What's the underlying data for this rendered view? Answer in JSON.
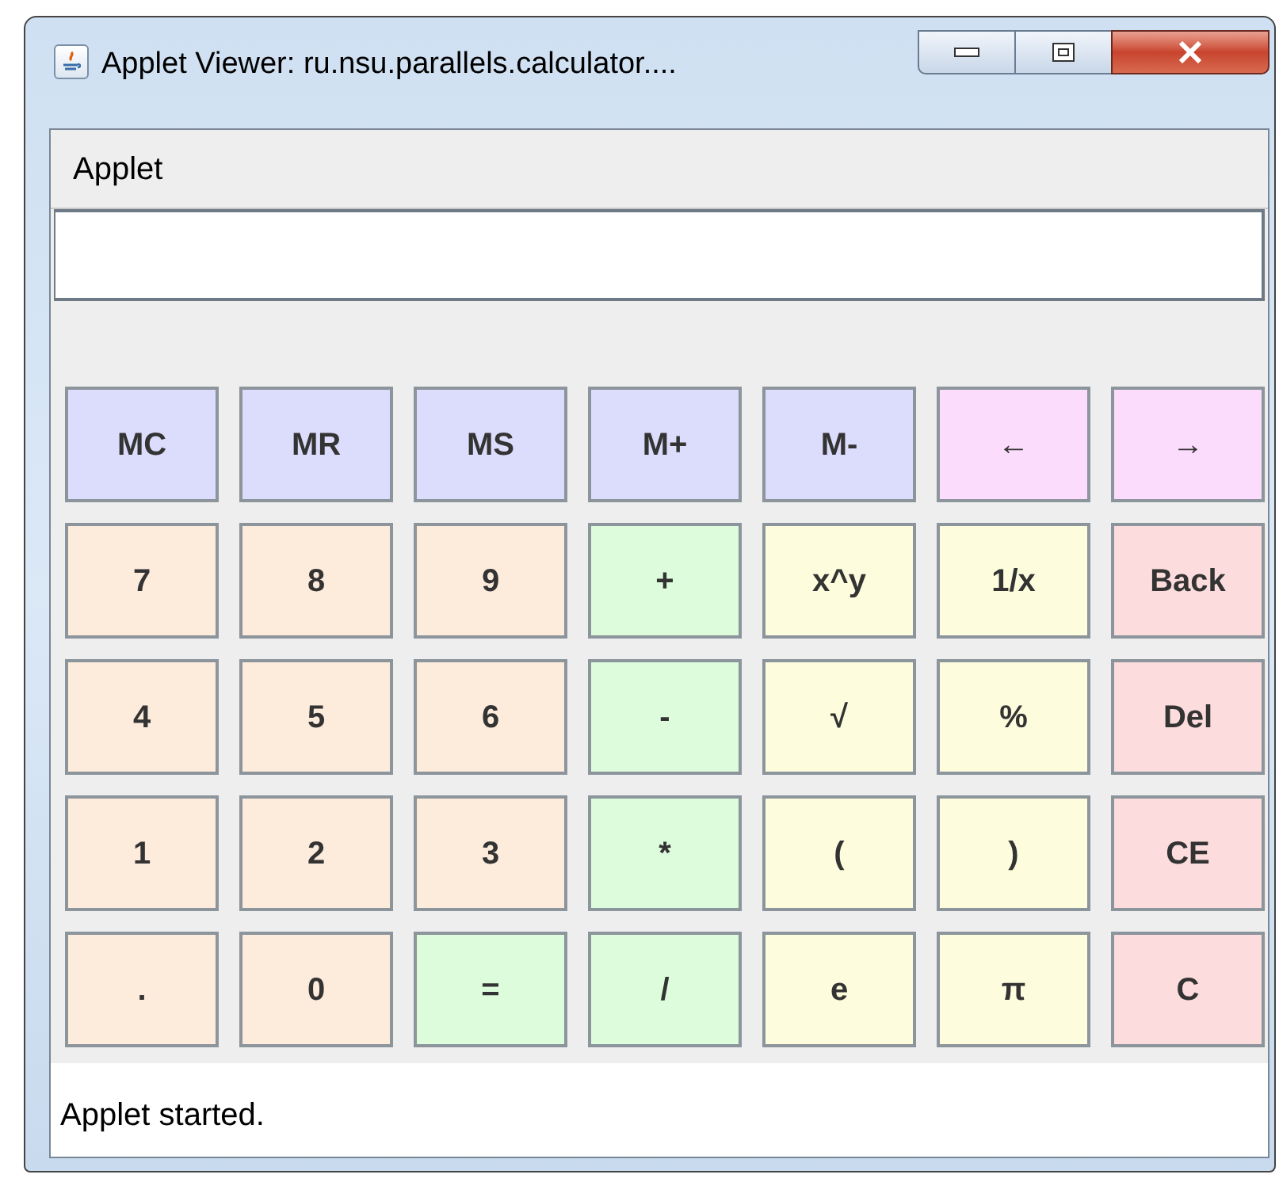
{
  "window": {
    "title": "Applet Viewer: ru.nsu.parallels.calculator...."
  },
  "menu": [
    "Applet"
  ],
  "buttons": [
    {
      "label": "MC",
      "color": "#dcdcfc"
    },
    {
      "label": "MR",
      "color": "#dcdcfc"
    },
    {
      "label": "MS",
      "color": "#dcdcfc"
    },
    {
      "label": "M+",
      "color": "#dcdcfc"
    },
    {
      "label": "M-",
      "color": "#dcdcfc"
    },
    {
      "label": "←",
      "color": "#fcdcfc"
    },
    {
      "label": "→",
      "color": "#fcdcfc"
    },
    {
      "label": "7",
      "color": "#fdebdc"
    },
    {
      "label": "8",
      "color": "#fdebdc"
    },
    {
      "label": "9",
      "color": "#fdebdc"
    },
    {
      "label": "+",
      "color": "#dcfcdc"
    },
    {
      "label": "x^y",
      "color": "#fdfcdc"
    },
    {
      "label": "1/x",
      "color": "#fdfcdc"
    },
    {
      "label": "Back",
      "color": "#fcdcdc"
    },
    {
      "label": "4",
      "color": "#fdebdc"
    },
    {
      "label": "5",
      "color": "#fdebdc"
    },
    {
      "label": "6",
      "color": "#fdebdc"
    },
    {
      "label": "-",
      "color": "#dcfcdc"
    },
    {
      "label": "√",
      "color": "#fdfcdc"
    },
    {
      "label": "%",
      "color": "#fdfcdc"
    },
    {
      "label": "Del",
      "color": "#fcdcdc"
    },
    {
      "label": "1",
      "color": "#fdebdc"
    },
    {
      "label": "2",
      "color": "#fdebdc"
    },
    {
      "label": "3",
      "color": "#fdebdc"
    },
    {
      "label": "*",
      "color": "#dcfcdc"
    },
    {
      "label": "(",
      "color": "#fdfcdc"
    },
    {
      "label": ")",
      "color": "#fdfcdc"
    },
    {
      "label": "CE",
      "color": "#fcdcdc"
    },
    {
      "label": ".",
      "color": "#fdebdc"
    },
    {
      "label": "0",
      "color": "#fdebdc"
    },
    {
      "label": "=",
      "color": "#dcfcdc"
    },
    {
      "label": "/",
      "color": "#dcfcdc"
    },
    {
      "label": "e",
      "color": "#fdfcdc"
    },
    {
      "label": "π",
      "color": "#fdfcdc"
    },
    {
      "label": "C",
      "color": "#fcdcdc"
    }
  ],
  "status_bar": "Applet started."
}
